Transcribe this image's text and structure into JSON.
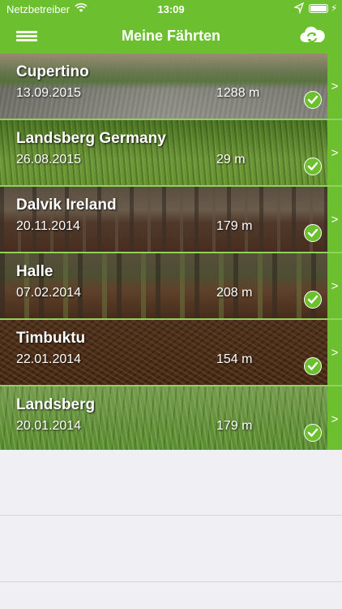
{
  "status_bar": {
    "carrier": "Netzbetreiber",
    "time": "13:09"
  },
  "nav": {
    "title": "Meine Fährten"
  },
  "colors": {
    "accent": "#6cc02f",
    "separator": "#8fd35a",
    "background": "#efeff4"
  },
  "icons": {
    "menu": "hamburger-menu-icon",
    "sync": "cloud-sync-icon",
    "done": "checkmark-circle-icon",
    "disclosure": "chevron-right-icon"
  },
  "tracks": [
    {
      "name": "Cupertino",
      "date": "13.09.2015",
      "distance": "1288 m",
      "chevron": ">"
    },
    {
      "name": "Landsberg Germany",
      "date": "26.08.2015",
      "distance": "29 m",
      "chevron": ">"
    },
    {
      "name": "Dalvik Ireland",
      "date": "20.11.2014",
      "distance": "179 m",
      "chevron": ">"
    },
    {
      "name": "Halle",
      "date": "07.02.2014",
      "distance": "208 m",
      "chevron": ">"
    },
    {
      "name": "Timbuktu",
      "date": "22.01.2014",
      "distance": "154 m",
      "chevron": ">"
    },
    {
      "name": "Landsberg",
      "date": "20.01.2014",
      "distance": "179 m",
      "chevron": ">"
    }
  ]
}
